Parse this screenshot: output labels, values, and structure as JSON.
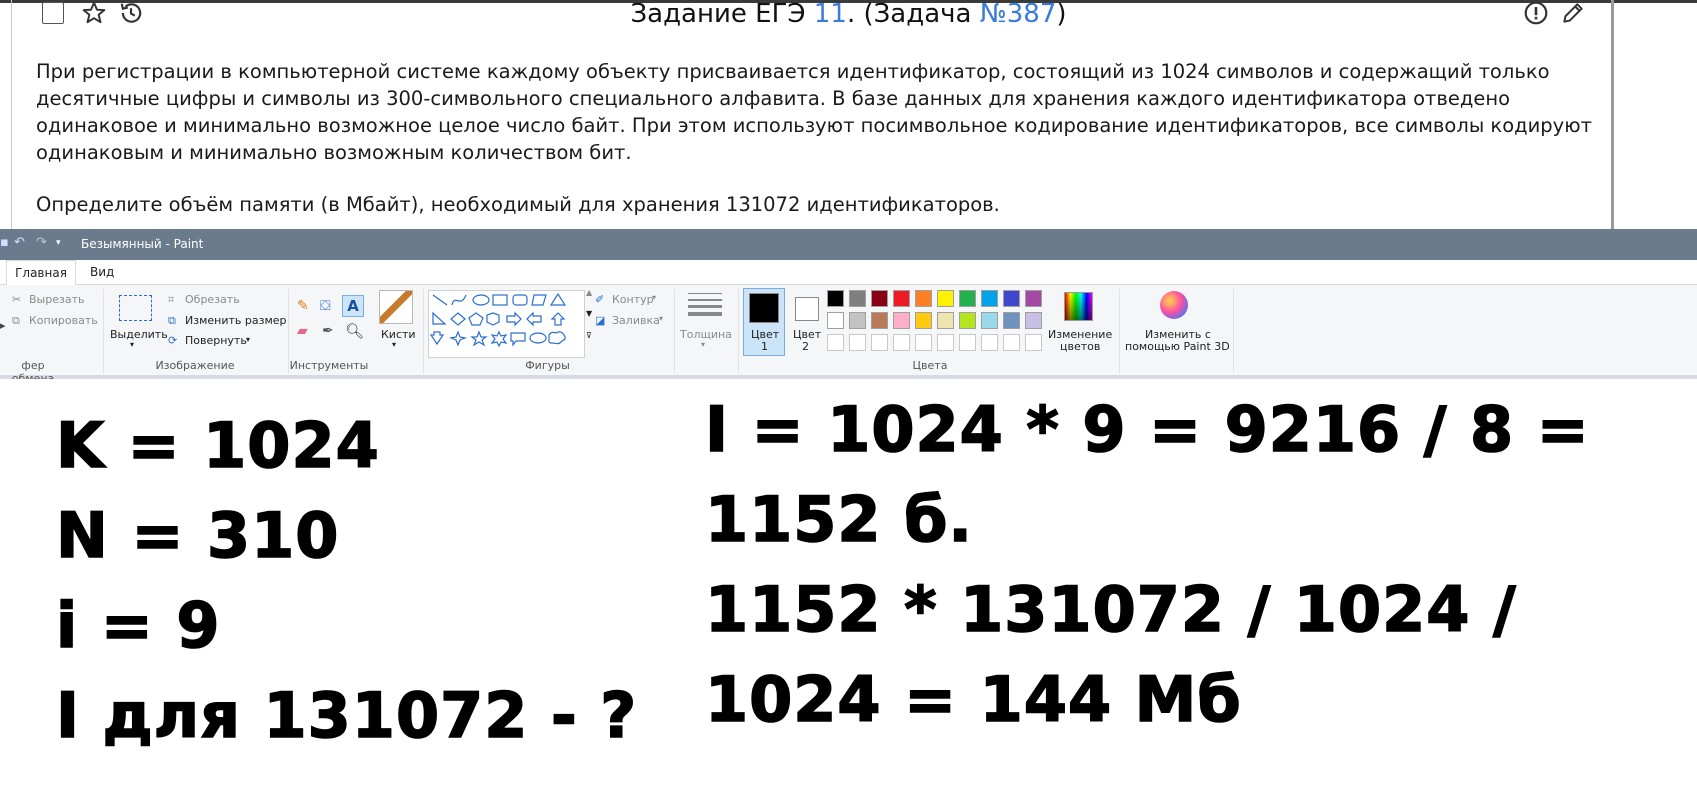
{
  "task": {
    "title_prefix": "Задание ЕГЭ ",
    "task_number": "11",
    "title_mid": ". (Задача ",
    "problem_number": "№387",
    "title_suffix": ")",
    "text": "При регистрации в компьютерной системе каждому объекту присваивается идентификатор, состоящий из 1024 символов и содержащий только десятичные цифры и символы из 300-символьного специального алфавита. В базе данных для хранения каждого идентификатора отведено одинаковое и минимально возможное целое число байт. При этом используют посимвольное кодирование идентификаторов, все символы кодируют одинаковым и минимально возможным количеством бит.",
    "question": "Определите объём памяти (в Мбайт), необходимый для хранения 131072 идентификаторов."
  },
  "paint": {
    "window_title": "Безымянный - Paint",
    "tabs": [
      "Главная",
      "Вид"
    ],
    "clipboard": {
      "cut": "Вырезать",
      "copy": "Копировать",
      "label": "фер обмена"
    },
    "image": {
      "select": "Выделить",
      "crop": "Обрезать",
      "resize": "Изменить размер",
      "rotate": "Повернуть",
      "label": "Изображение"
    },
    "tools": {
      "label": "Инструменты",
      "brushes": "Кисти"
    },
    "shapes": {
      "label": "Фигуры",
      "outline": "Контур",
      "fill": "Заливка"
    },
    "thickness": "Толщина",
    "colors": {
      "color1_line1": "Цвет",
      "color1_line2": "1",
      "color2_line1": "Цвет",
      "color2_line2": "2",
      "edit_line1": "Изменение",
      "edit_line2": "цветов",
      "label": "Цвета",
      "color1": "#000000",
      "color2": "#ffffff",
      "palette_row1": [
        "#000000",
        "#7f7f7f",
        "#880015",
        "#ed1c24",
        "#ff7f27",
        "#fff200",
        "#22b14c",
        "#00a2e8",
        "#3f48cc",
        "#a349a4"
      ],
      "palette_row2": [
        "#ffffff",
        "#c3c3c3",
        "#b97a57",
        "#ffaec9",
        "#ffc90e",
        "#efe4b0",
        "#b5e61d",
        "#99d9ea",
        "#7092be",
        "#c8bfe7"
      ],
      "palette_row3": [
        "#ffffff",
        "#ffffff",
        "#ffffff",
        "#ffffff",
        "#ffffff",
        "#ffffff",
        "#ffffff",
        "#ffffff",
        "#ffffff",
        "#ffffff"
      ]
    },
    "paint3d_line1": "Изменить с",
    "paint3d_line2": "помощью Paint 3D"
  },
  "canvas": {
    "left_lines": [
      "K = 1024",
      "N = 310",
      "i = 9",
      "I для 131072 - ?"
    ],
    "right_lines": [
      "I = 1024 * 9 = 9216 / 8 =",
      "1152 б.",
      "1152 * 131072 / 1024 /",
      "1024 = 144 Мб"
    ]
  }
}
